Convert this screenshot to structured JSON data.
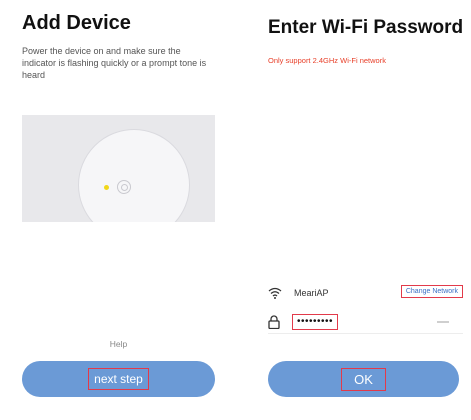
{
  "add_device": {
    "title": "Add Device",
    "instruction": "Power the device on and make sure the indicator is flashing quickly or a prompt tone is heard",
    "help": "Help",
    "next_button": "next step"
  },
  "wifi_password": {
    "title": "Enter Wi-Fi Password",
    "warning": "Only support 2.4GHz Wi-Fi network",
    "ssid": "MeariAP",
    "change_network": "Change Network",
    "password_masked": "•••••••••",
    "ok_button": "OK"
  },
  "colors": {
    "button": "#6b9ad6",
    "warning": "#e8402a",
    "highlight_box": "#e23a4a",
    "link": "#3b6fc4"
  }
}
